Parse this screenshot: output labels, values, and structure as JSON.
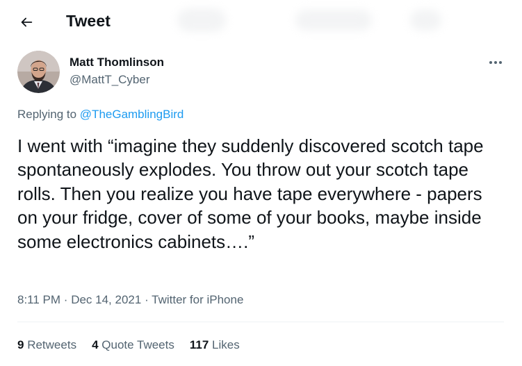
{
  "header": {
    "title": "Tweet",
    "back_icon": "arrow-left-icon"
  },
  "author": {
    "name": "Matt Thomlinson",
    "handle": "@MattT_Cyber"
  },
  "reply": {
    "prefix": "Replying to",
    "target": "@TheGamblingBird"
  },
  "tweet": {
    "text": "I went with “imagine they suddenly discovered scotch tape spontaneously explodes. You throw out your scotch tape rolls. Then you realize you have tape everywhere - papers on your fridge, cover of some of your books, maybe inside some electronics cabinets….”",
    "time": "8:11 PM",
    "date": "Dec 14, 2021",
    "source": "Twitter for iPhone"
  },
  "stats": {
    "retweets_count": "9",
    "retweets_label": "Retweets",
    "quotes_count": "4",
    "quotes_label": "Quote Tweets",
    "likes_count": "117",
    "likes_label": "Likes"
  },
  "colors": {
    "accent": "#1d9bf0",
    "text_primary": "#0f1419",
    "text_secondary": "#536471"
  }
}
